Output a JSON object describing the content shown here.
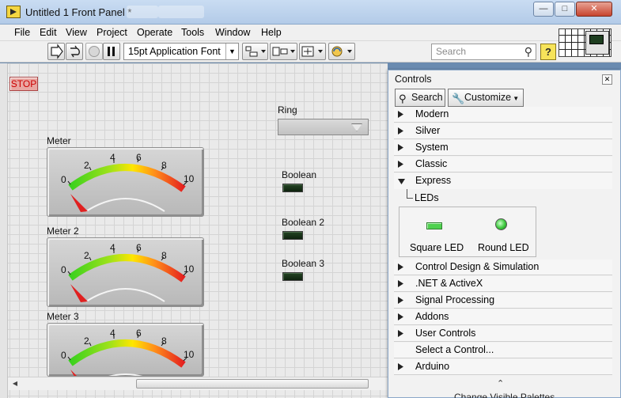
{
  "window": {
    "title": "Untitled 1 Front Panel *",
    "minimize": "—",
    "maximize": "□",
    "close": "✕"
  },
  "menu": [
    "File",
    "Edit",
    "View",
    "Project",
    "Operate",
    "Tools",
    "Window",
    "Help"
  ],
  "toolbar": {
    "font": "15pt Application Font",
    "search_placeholder": "Search",
    "help": "?"
  },
  "panel": {
    "stop_label": "STOP",
    "ring_label": "Ring",
    "meters": [
      {
        "label": "Meter",
        "scale": [
          "0",
          "2",
          "4",
          "6",
          "8",
          "10"
        ]
      },
      {
        "label": "Meter 2",
        "scale": [
          "0",
          "2",
          "4",
          "6",
          "8",
          "10"
        ]
      },
      {
        "label": "Meter 3",
        "scale": [
          "0",
          "2",
          "4",
          "6",
          "8",
          "10"
        ]
      }
    ],
    "booleans": [
      "Boolean",
      "Boolean 2",
      "Boolean 3"
    ]
  },
  "palette": {
    "title": "Controls",
    "search_button": "Search",
    "customize_button": "Customize",
    "categories_top": [
      "Modern",
      "Silver",
      "System",
      "Classic"
    ],
    "expanded_category": "Express",
    "subcategory": "LEDs",
    "leds": [
      "Square LED",
      "Round LED"
    ],
    "categories_bottom": [
      "Control Design & Simulation",
      ".NET & ActiveX",
      "Signal Processing",
      "Addons",
      "User Controls",
      "Select a Control...",
      "Arduino"
    ],
    "footer": "Change Visible Palettes..."
  },
  "colors": {
    "stop_text": "#cc0000",
    "meter_green": "#3ad11f",
    "meter_yellow": "#ffe600",
    "meter_red": "#e42020",
    "led_off": "#1a3a1a",
    "led_on": "#4fd14f"
  }
}
